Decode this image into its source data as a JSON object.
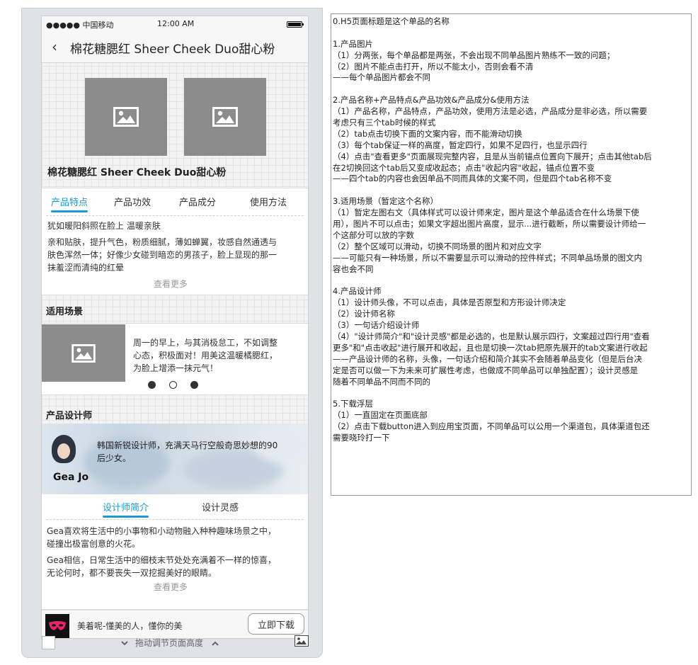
{
  "status_bar": {
    "carrier": "●●●●● 中国移动",
    "time": "12:00 AM"
  },
  "nav": {
    "back_glyph": "‹",
    "title": "棉花糖腮红 Sheer Cheek Duo甜心粉"
  },
  "product": {
    "name": "棉花糖腮红 Sheer Cheek Duo甜心粉"
  },
  "product_tabs": {
    "items": [
      "产品特点",
      "产品功效",
      "产品成分",
      "使用方法"
    ],
    "lines": [
      "犹如暖阳斜照在脸上 温暖亲肤",
      "亲和贴肤，提升气色，粉质细腻，薄如蝉翼，妆感自然通透与",
      "肤色浑然一体；好像少女碰到暗恋的男孩子，脸上显现的那一",
      "抹羞涩而清纯的红晕"
    ],
    "more": "查看更多"
  },
  "scene": {
    "title": "适用场景",
    "lines": [
      "周一的早上，与其消极怠工，不如调整",
      "心态，积极面对！用美这温暖橘腮红，",
      "为脸上增添一抹元气！"
    ]
  },
  "designer": {
    "title": "产品设计师",
    "name": "Gea Jo",
    "intro_lines": [
      "韩国新锐设计师，充满天马行空般奇思妙想的90",
      "后少女。"
    ],
    "tabs": [
      "设计师简介",
      "设计灵感"
    ],
    "para1": [
      "Gea喜欢将生活中的小事物和小动物融入种种趣味场景之中，",
      "碰撞出极富创意的火花。"
    ],
    "para2": [
      "Gea相信，日常生活中的细枝末节处处充满着不一样的惊喜，",
      "无论何时，都不要丧失一双挖掘美好的眼睛。"
    ],
    "more": "查看更多"
  },
  "download": {
    "slogan": "美着呢-懂美的人，懂你的美",
    "button": "立即下载"
  },
  "frame_footer": {
    "resize_label": "拖动调节页面高度"
  },
  "notes": [
    "0.H5页面标题是这个单品的名称",
    "",
    "1.产品图片",
    "（1）分两张，每个单品都是两张，不会出现不同单品图片熟练不一致的问题；",
    "（2）图片不能点击打开，所以不能太小，否则会看不清",
    "——每个单品图片都会不同",
    "",
    "2.产品名称+产品特点&产品功效&产品成分&使用方法",
    "（1）产品名称，产品特点，产品功效，使用方法是必选，产品成分是非必选，所以需要",
    "考虑只有三个tab时候的样式",
    "（2）tab点击切换下面的文案内容，而不能滑动切换",
    "（3）每个tab保证一样的高度，暂定四行，如果不足四行，也显示四行",
    "（4）点击\"查看更多\"页面展现完整内容，且是从当前锚点位置向下展开；点击其他tab后",
    "在2切换回这个tab后又变成收起态；点击\"收起内容\"收起，锚点位置不变",
    "——四个tab的内容也会因单品不同而具体的文案不同，但是四个tab名称不变",
    "",
    "3.适用场景（暂定这个名称）",
    "（1）暂定左图右文（具体样式可以设计师来定，图片是这个单品适合在什么场景下使",
    "用），图片不可以点击；如果文字超出图片高度，显示...进行截断，所以需要设计师给一",
    "个这部分可以放的字数",
    "（2）整个区域可以滑动，切换不同场景的图片和对应文字",
    "——可能只有一种场景，所以不需要显示可以滑动的控件样式；不同单品场景的图文内",
    "容也会不同",
    "",
    "4.产品设计师",
    "（1）设计师头像，不可以点击，具体是否原型和方形设计师决定",
    "（2）设计师名称",
    "（3）一句话介绍设计师",
    "（4）\"设计师简介\"和\"设计灵感\"都是必选的，也是默认展示四行，文案超过四行用\"查看",
    "更多\"和\"点击收起\"进行展开和收起，且也是切换一次tab把原先展开的tab文案进行收起",
    "——产品设计师的名称，头像，一句话介绍和简介其实不会随着单品变化（但是后台决",
    "定是否可以做一下为未来可扩展性考虑，也做成不同单品可以单独配置）；设计灵感是",
    "随着不同单品不同而不同的",
    "",
    "5.下载浮层",
    "（1）一直固定在页面底部",
    "（2）点击下载button进入到应用宝页面，不同单品可以公用一个渠道包，具体渠道包还",
    "需要晓玲打一下"
  ]
}
